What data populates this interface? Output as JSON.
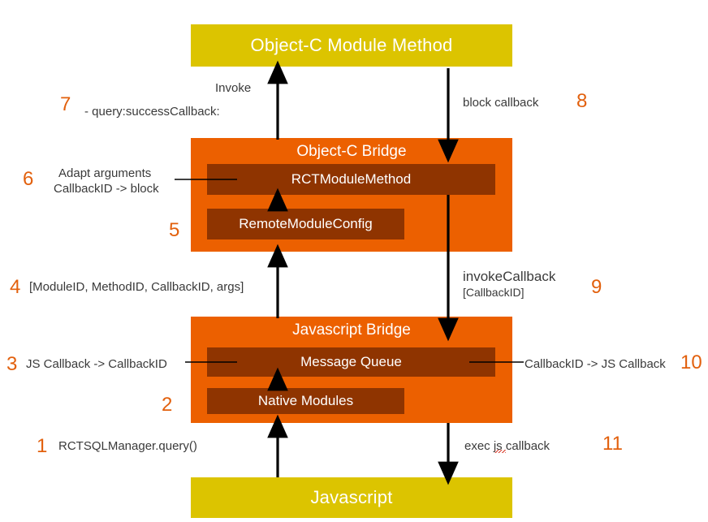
{
  "diagram": {
    "title": "React Native bridge call flow",
    "colors": {
      "yellow": "#dcc400",
      "orange": "#ec6000",
      "brown": "#8f3400",
      "number": "#e2600d",
      "text": "#3a3a3a",
      "arrow": "#000000"
    },
    "nodes": {
      "objc_module_method": "Object-C Module Method",
      "objc_bridge": "Object-C Bridge",
      "rct_module_method": "RCTModuleMethod",
      "remote_module_config": "RemoteModuleConfig",
      "js_bridge": "Javascript Bridge",
      "message_queue": "Message Queue",
      "native_modules": "Native Modules",
      "javascript": "Javascript"
    },
    "steps": [
      {
        "number": "1",
        "text": "RCTSQLManager.query()"
      },
      {
        "number": "2",
        "text": ""
      },
      {
        "number": "3",
        "text": "JS Callback -> CallbackID"
      },
      {
        "number": "4",
        "text": "[ModuleID, MethodID, CallbackID, args]"
      },
      {
        "number": "5",
        "text": ""
      },
      {
        "number": "6",
        "text": "Adapt arguments\nCallbackID -> block"
      },
      {
        "number": "7",
        "text": "Invoke\n- query:successCallback:"
      },
      {
        "number": "8",
        "text": "block callback"
      },
      {
        "number": "9",
        "text": "invokeCallback\n[CallbackID]"
      },
      {
        "number": "10",
        "text": "CallbackID -> JS Callback"
      },
      {
        "number": "11",
        "text": "exec js callback"
      }
    ],
    "labels": {
      "step1_text": "RCTSQLManager.query()",
      "step3_text": "JS Callback -> CallbackID",
      "step4_text": "[ModuleID, MethodID, CallbackID, args]",
      "step6_line1": "Adapt arguments",
      "step6_line2": "CallbackID -> block",
      "step7_line1": "Invoke",
      "step7_line2": "- query:successCallback:",
      "step8_text": "block callback",
      "step9_line1": "invokeCallback",
      "step9_line2": "[CallbackID]",
      "step10_text": "CallbackID -> JS Callback",
      "step11_text": "exec js callback"
    },
    "numbers": {
      "n1": "1",
      "n2": "2",
      "n3": "3",
      "n4": "4",
      "n5": "5",
      "n6": "6",
      "n7": "7",
      "n8": "8",
      "n9": "9",
      "n10": "10",
      "n11": "11"
    }
  }
}
